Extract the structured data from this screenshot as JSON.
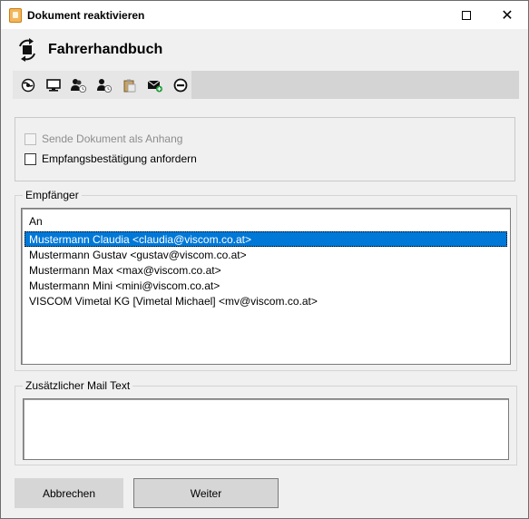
{
  "window": {
    "title": "Dokument reaktivieren",
    "controls": {
      "maximize": "maximize",
      "close": "✕"
    }
  },
  "header": {
    "title": "Fahrerhandbuch",
    "icon": "sync-arrows-icon"
  },
  "toolbar": {
    "buttons": [
      {
        "name": "globe-icon"
      },
      {
        "name": "monitor-icon"
      },
      {
        "name": "users-clock-icon"
      },
      {
        "name": "user-clock-icon"
      },
      {
        "name": "clipboard-icon"
      },
      {
        "name": "mail-add-icon"
      },
      {
        "name": "remove-icon"
      }
    ]
  },
  "options": {
    "send_as_attachment": {
      "label": "Sende Dokument als Anhang",
      "checked": false,
      "disabled": true
    },
    "read_receipt": {
      "label": "Empfangsbestätigung anfordern",
      "checked": false,
      "disabled": false
    }
  },
  "recipients": {
    "legend": "Empfänger",
    "column_header": "An",
    "items": [
      {
        "text": "Mustermann Claudia <claudia@viscom.co.at>",
        "selected": true
      },
      {
        "text": "Mustermann Gustav <gustav@viscom.co.at>",
        "selected": false
      },
      {
        "text": "Mustermann Max <max@viscom.co.at>",
        "selected": false
      },
      {
        "text": "Mustermann Mini <mini@viscom.co.at>",
        "selected": false
      },
      {
        "text": "VISCOM Vimetal KG [Vimetal Michael] <mv@viscom.co.at>",
        "selected": false
      }
    ]
  },
  "mail_text": {
    "legend": "Zusätzlicher Mail Text",
    "value": ""
  },
  "buttons": {
    "cancel": "Abbrechen",
    "next": "Weiter"
  }
}
